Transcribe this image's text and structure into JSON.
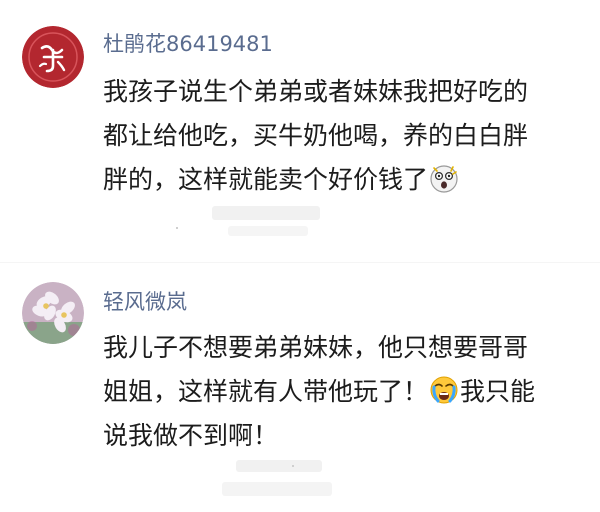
{
  "comments": [
    {
      "username": "杜鹃花86419481",
      "avatar_icon": "red-seal-icon",
      "lines": [
        "我孩子说生个弟弟或者妹妹我把好吃的",
        "都让给他吃，买牛奶他喝，养的白白胖",
        "胖的，这样就能卖个好价钱了"
      ],
      "trailing_emoji": "shocked-face-icon"
    },
    {
      "username": "轻风微岚",
      "avatar_icon": "flower-photo-icon",
      "lines": [
        "我儿子不想要弟弟妹妹，他只想要哥哥",
        "姐姐，这样就有人带他玩了！",
        "我只能",
        "说我做不到啊！"
      ],
      "inline_emoji": "crying-face-icon"
    }
  ],
  "colors": {
    "username": "#5a6c8f",
    "text": "#1c1c1c",
    "seal_red": "#b3272f",
    "background": "#ffffff"
  }
}
